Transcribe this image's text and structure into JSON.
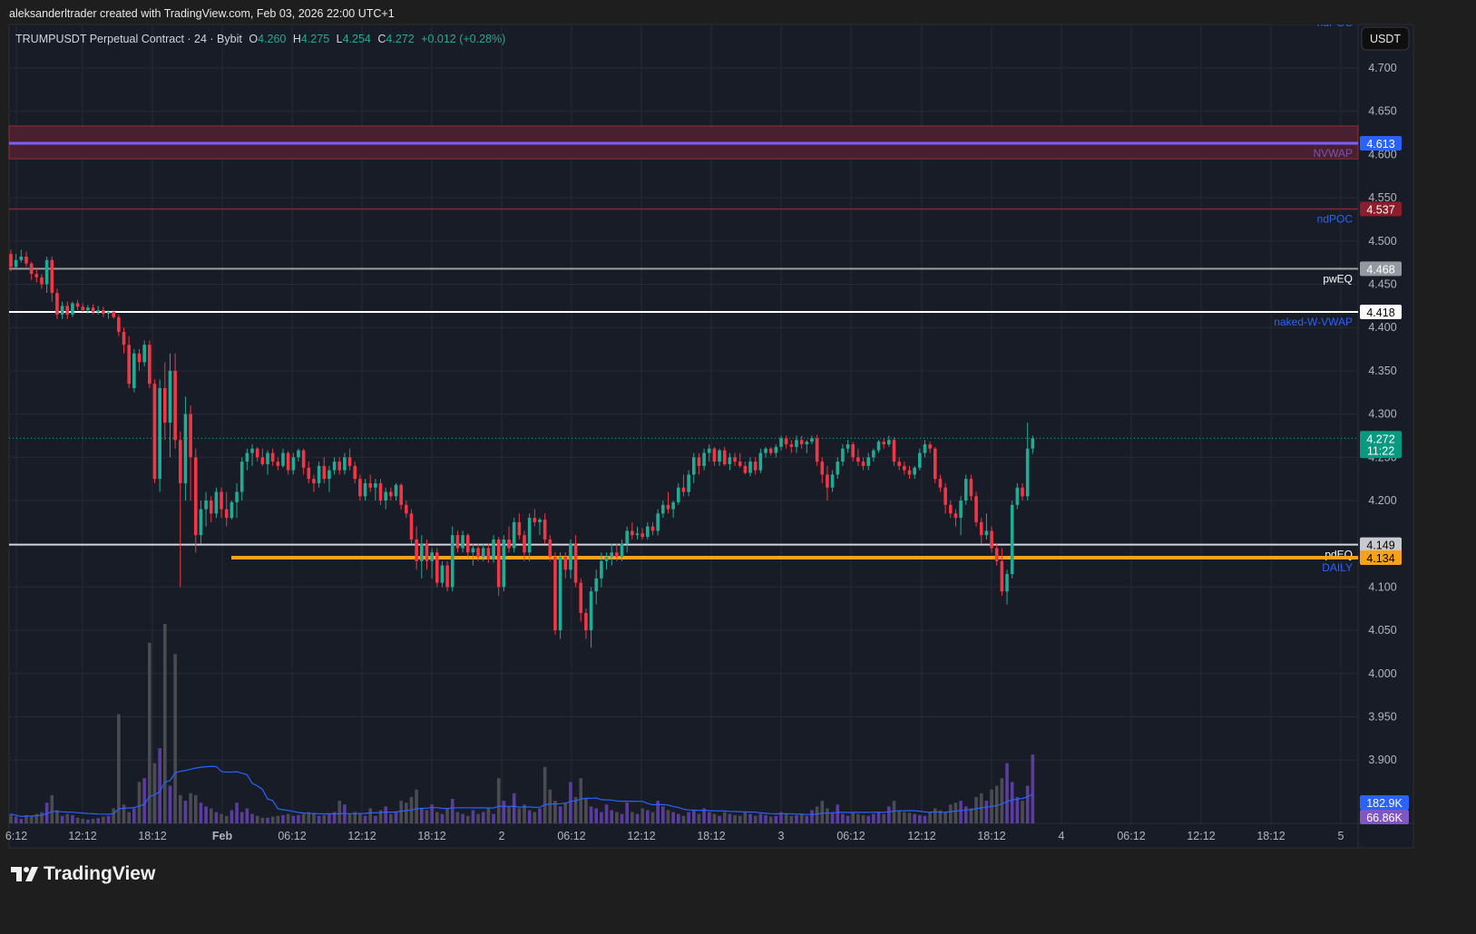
{
  "header": {
    "attribution": "aleksanderltrader created with TradingView.com, Feb 03, 2026 22:00 UTC+1"
  },
  "legend": {
    "symbol": "TRUMPUSDT Perpetual Contract · 24 · Bybit",
    "o_label": "O",
    "o": "4.260",
    "h_label": "H",
    "h": "4.275",
    "l_label": "L",
    "l": "4.254",
    "c_label": "C",
    "c": "4.272",
    "change": "+0.012 (+0.28%)"
  },
  "currency_button": "USDT",
  "brand": "TradingView",
  "colors": {
    "up": "#22ab94",
    "down": "#f23645",
    "vol_up": "#5b3c9f",
    "vol_down": "#4b4b52",
    "vol_ma": "#2962ff",
    "daily": "#f7a21b"
  },
  "chart_data": {
    "type": "candlestick",
    "title": "TRUMPUSDT Perpetual Contract · 24 · Bybit",
    "ylim": [
      3.88,
      4.73
    ],
    "y_ticks": [
      "4.700",
      "4.650",
      "4.600",
      "4.550",
      "4.500",
      "4.450",
      "4.400",
      "4.350",
      "4.300",
      "4.250",
      "4.200",
      "4.150",
      "4.100",
      "4.050",
      "4.000",
      "3.950",
      "3.900"
    ],
    "x_ticks": [
      "6:12",
      "12:12",
      "18:12",
      "Feb",
      "06:12",
      "12:12",
      "18:12",
      "2",
      "06:12",
      "12:12",
      "18:12",
      "3",
      "06:12",
      "12:12",
      "18:12",
      "4",
      "06:12",
      "12:12",
      "18:12",
      "5"
    ],
    "levels": [
      {
        "name": "NVWAP",
        "price": 4.613,
        "label": "4.613",
        "zone": [
          4.595,
          4.633
        ]
      },
      {
        "name": "ndPOC",
        "price": 4.537,
        "label": "4.537"
      },
      {
        "name": "pwEQ",
        "price": 4.468,
        "label": "4.468"
      },
      {
        "name": "naked-W-VWAP",
        "price": 4.418,
        "label": "4.418"
      },
      {
        "name": "pdEQ",
        "price": 4.149,
        "label": "4.149"
      },
      {
        "name": "DAILY",
        "price": 4.134,
        "label": "4.134"
      }
    ],
    "top_clipped_level": "ndPOC",
    "last_price": {
      "price": 4.272,
      "label": "4.272",
      "countdown": "11:22"
    },
    "volume_labels": {
      "last": "182.9K",
      "ma": "66.86K"
    },
    "candles": [
      [
        4.485,
        4.49,
        4.465,
        4.47
      ],
      [
        4.47,
        4.485,
        4.468,
        4.478
      ],
      [
        4.478,
        4.49,
        4.475,
        4.482
      ],
      [
        4.482,
        4.488,
        4.47,
        4.474
      ],
      [
        4.474,
        4.476,
        4.455,
        4.462
      ],
      [
        4.462,
        4.468,
        4.452,
        4.458
      ],
      [
        4.458,
        4.462,
        4.445,
        4.45
      ],
      [
        4.45,
        4.482,
        4.44,
        4.478
      ],
      [
        4.478,
        4.482,
        4.43,
        4.44
      ],
      [
        4.44,
        4.445,
        4.41,
        4.415
      ],
      [
        4.415,
        4.43,
        4.41,
        4.425
      ],
      [
        4.425,
        4.43,
        4.41,
        4.415
      ],
      [
        4.415,
        4.43,
        4.412,
        4.428
      ],
      [
        4.428,
        4.432,
        4.42,
        4.424
      ],
      [
        4.424,
        4.428,
        4.418,
        4.42
      ],
      [
        4.42,
        4.426,
        4.416,
        4.423
      ],
      [
        4.423,
        4.427,
        4.415,
        4.418
      ],
      [
        4.418,
        4.425,
        4.415,
        4.42
      ],
      [
        4.42,
        4.424,
        4.412,
        4.416
      ],
      [
        4.416,
        4.42,
        4.41,
        4.418
      ],
      [
        4.418,
        4.42,
        4.41,
        4.412
      ],
      [
        4.412,
        4.415,
        4.39,
        4.395
      ],
      [
        4.395,
        4.4,
        4.37,
        4.38
      ],
      [
        4.38,
        4.39,
        4.33,
        4.335
      ],
      [
        4.33,
        4.375,
        4.325,
        4.37
      ],
      [
        4.37,
        4.375,
        4.35,
        4.36
      ],
      [
        4.36,
        4.385,
        4.355,
        4.38
      ],
      [
        4.38,
        4.385,
        4.33,
        4.335
      ],
      [
        4.335,
        4.34,
        4.22,
        4.225
      ],
      [
        4.225,
        4.34,
        4.21,
        4.33
      ],
      [
        4.33,
        4.36,
        4.27,
        4.29
      ],
      [
        4.29,
        4.37,
        4.25,
        4.35
      ],
      [
        4.35,
        4.37,
        4.26,
        4.27
      ],
      [
        4.27,
        4.28,
        4.1,
        4.22
      ],
      [
        4.22,
        4.32,
        4.2,
        4.3
      ],
      [
        4.3,
        4.31,
        4.2,
        4.25
      ],
      [
        4.25,
        4.26,
        4.14,
        4.16
      ],
      [
        4.16,
        4.2,
        4.15,
        4.19
      ],
      [
        4.19,
        4.21,
        4.17,
        4.2
      ],
      [
        4.2,
        4.205,
        4.175,
        4.185
      ],
      [
        4.185,
        4.215,
        4.18,
        4.21
      ],
      [
        4.21,
        4.215,
        4.18,
        4.19
      ],
      [
        4.19,
        4.21,
        4.17,
        4.18
      ],
      [
        4.18,
        4.2,
        4.178,
        4.198
      ],
      [
        4.198,
        4.22,
        4.18,
        4.21
      ],
      [
        4.21,
        4.25,
        4.2,
        4.245
      ],
      [
        4.245,
        4.26,
        4.235,
        4.255
      ],
      [
        4.255,
        4.265,
        4.24,
        4.26
      ],
      [
        4.26,
        4.262,
        4.245,
        4.25
      ],
      [
        4.25,
        4.26,
        4.24,
        4.242
      ],
      [
        4.242,
        4.258,
        4.23,
        4.255
      ],
      [
        4.255,
        4.26,
        4.24,
        4.245
      ],
      [
        4.245,
        4.25,
        4.235,
        4.24
      ],
      [
        4.24,
        4.26,
        4.238,
        4.255
      ],
      [
        4.255,
        4.257,
        4.23,
        4.235
      ],
      [
        4.235,
        4.255,
        4.23,
        4.25
      ],
      [
        4.25,
        4.26,
        4.245,
        4.258
      ],
      [
        4.258,
        4.26,
        4.23,
        4.238
      ],
      [
        4.238,
        4.245,
        4.22,
        4.225
      ],
      [
        4.225,
        4.23,
        4.21,
        4.22
      ],
      [
        4.22,
        4.245,
        4.215,
        4.24
      ],
      [
        4.24,
        4.25,
        4.22,
        4.225
      ],
      [
        4.225,
        4.24,
        4.21,
        4.235
      ],
      [
        4.235,
        4.25,
        4.23,
        4.245
      ],
      [
        4.245,
        4.25,
        4.23,
        4.235
      ],
      [
        4.235,
        4.255,
        4.23,
        4.25
      ],
      [
        4.25,
        4.26,
        4.235,
        4.24
      ],
      [
        4.24,
        4.245,
        4.22,
        4.225
      ],
      [
        4.225,
        4.23,
        4.2,
        4.205
      ],
      [
        4.205,
        4.225,
        4.2,
        4.22
      ],
      [
        4.22,
        4.23,
        4.21,
        4.215
      ],
      [
        4.215,
        4.225,
        4.2,
        4.22
      ],
      [
        4.22,
        4.225,
        4.195,
        4.2
      ],
      [
        4.2,
        4.215,
        4.19,
        4.21
      ],
      [
        4.21,
        4.215,
        4.2,
        4.205
      ],
      [
        4.205,
        4.22,
        4.2,
        4.218
      ],
      [
        4.218,
        4.22,
        4.19,
        4.195
      ],
      [
        4.195,
        4.2,
        4.18,
        4.185
      ],
      [
        4.185,
        4.19,
        4.15,
        4.155
      ],
      [
        4.155,
        4.17,
        4.12,
        4.13
      ],
      [
        4.13,
        4.16,
        4.11,
        4.15
      ],
      [
        4.15,
        4.155,
        4.12,
        4.13
      ],
      [
        4.13,
        4.145,
        4.11,
        4.14
      ],
      [
        4.14,
        4.145,
        4.1,
        4.105
      ],
      [
        4.105,
        4.13,
        4.1,
        4.125
      ],
      [
        4.125,
        4.13,
        4.095,
        4.1
      ],
      [
        4.1,
        4.17,
        4.095,
        4.16
      ],
      [
        4.16,
        4.165,
        4.14,
        4.145
      ],
      [
        4.145,
        4.165,
        4.14,
        4.16
      ],
      [
        4.16,
        4.162,
        4.135,
        4.14
      ],
      [
        4.14,
        4.15,
        4.125,
        4.145
      ],
      [
        4.145,
        4.15,
        4.13,
        4.135
      ],
      [
        4.135,
        4.15,
        4.13,
        4.145
      ],
      [
        4.145,
        4.15,
        4.128,
        4.132
      ],
      [
        4.132,
        4.16,
        4.128,
        4.155
      ],
      [
        4.155,
        4.158,
        4.09,
        4.1
      ],
      [
        4.1,
        4.16,
        4.095,
        4.155
      ],
      [
        4.155,
        4.17,
        4.14,
        4.145
      ],
      [
        4.145,
        4.18,
        4.14,
        4.175
      ],
      [
        4.175,
        4.185,
        4.155,
        4.16
      ],
      [
        4.16,
        4.165,
        4.13,
        4.14
      ],
      [
        4.14,
        4.185,
        4.13,
        4.18
      ],
      [
        4.18,
        4.19,
        4.17,
        4.175
      ],
      [
        4.175,
        4.18,
        4.16,
        4.178
      ],
      [
        4.178,
        4.185,
        4.15,
        4.155
      ],
      [
        4.155,
        4.16,
        4.13,
        4.135
      ],
      [
        4.135,
        4.14,
        4.045,
        4.05
      ],
      [
        4.05,
        4.14,
        4.04,
        4.135
      ],
      [
        4.135,
        4.14,
        4.11,
        4.12
      ],
      [
        4.12,
        4.155,
        4.11,
        4.15
      ],
      [
        4.15,
        4.16,
        4.1,
        4.105
      ],
      [
        4.105,
        4.11,
        4.06,
        4.07
      ],
      [
        4.07,
        4.075,
        4.04,
        4.05
      ],
      [
        4.05,
        4.1,
        4.03,
        4.095
      ],
      [
        4.095,
        4.12,
        4.08,
        4.11
      ],
      [
        4.11,
        4.14,
        4.1,
        4.13
      ],
      [
        4.13,
        4.14,
        4.12,
        4.135
      ],
      [
        4.135,
        4.15,
        4.125,
        4.14
      ],
      [
        4.14,
        4.15,
        4.13,
        4.135
      ],
      [
        4.135,
        4.155,
        4.13,
        4.15
      ],
      [
        4.15,
        4.17,
        4.14,
        4.165
      ],
      [
        4.165,
        4.175,
        4.155,
        4.16
      ],
      [
        4.16,
        4.17,
        4.155,
        4.162
      ],
      [
        4.162,
        4.168,
        4.155,
        4.158
      ],
      [
        4.158,
        4.175,
        4.155,
        4.17
      ],
      [
        4.17,
        4.175,
        4.16,
        4.165
      ],
      [
        4.165,
        4.19,
        4.16,
        4.185
      ],
      [
        4.185,
        4.2,
        4.18,
        4.195
      ],
      [
        4.195,
        4.21,
        4.185,
        4.19
      ],
      [
        4.19,
        4.2,
        4.18,
        4.198
      ],
      [
        4.198,
        4.22,
        4.195,
        4.215
      ],
      [
        4.215,
        4.23,
        4.205,
        4.21
      ],
      [
        4.21,
        4.235,
        4.205,
        4.23
      ],
      [
        4.23,
        4.255,
        4.22,
        4.25
      ],
      [
        4.25,
        4.255,
        4.23,
        4.24
      ],
      [
        4.24,
        4.26,
        4.235,
        4.255
      ],
      [
        4.255,
        4.265,
        4.245,
        4.26
      ],
      [
        4.26,
        4.262,
        4.24,
        4.245
      ],
      [
        4.245,
        4.26,
        4.24,
        4.258
      ],
      [
        4.258,
        4.262,
        4.24,
        4.242
      ],
      [
        4.242,
        4.255,
        4.235,
        4.25
      ],
      [
        4.25,
        4.255,
        4.24,
        4.245
      ],
      [
        4.245,
        4.255,
        4.238,
        4.24
      ],
      [
        4.24,
        4.245,
        4.23,
        4.232
      ],
      [
        4.232,
        4.25,
        4.228,
        4.245
      ],
      [
        4.245,
        4.25,
        4.23,
        4.235
      ],
      [
        4.235,
        4.26,
        4.232,
        4.255
      ],
      [
        4.255,
        4.262,
        4.25,
        4.26
      ],
      [
        4.26,
        4.262,
        4.252,
        4.255
      ],
      [
        4.255,
        4.265,
        4.25,
        4.262
      ],
      [
        4.262,
        4.275,
        4.258,
        4.272
      ],
      [
        4.272,
        4.275,
        4.26,
        4.265
      ],
      [
        4.265,
        4.27,
        4.255,
        4.262
      ],
      [
        4.262,
        4.275,
        4.255,
        4.27
      ],
      [
        4.27,
        4.275,
        4.26,
        4.265
      ],
      [
        4.265,
        4.27,
        4.255,
        4.268
      ],
      [
        4.268,
        4.275,
        4.265,
        4.272
      ],
      [
        4.272,
        4.276,
        4.24,
        4.245
      ],
      [
        4.245,
        4.25,
        4.22,
        4.23
      ],
      [
        4.23,
        4.24,
        4.2,
        4.215
      ],
      [
        4.215,
        4.235,
        4.21,
        4.23
      ],
      [
        4.23,
        4.25,
        4.225,
        4.245
      ],
      [
        4.245,
        4.265,
        4.24,
        4.26
      ],
      [
        4.26,
        4.27,
        4.255,
        4.265
      ],
      [
        4.265,
        4.268,
        4.245,
        4.25
      ],
      [
        4.25,
        4.26,
        4.24,
        4.245
      ],
      [
        4.245,
        4.25,
        4.235,
        4.24
      ],
      [
        4.24,
        4.255,
        4.235,
        4.25
      ],
      [
        4.25,
        4.26,
        4.245,
        4.258
      ],
      [
        4.258,
        4.27,
        4.255,
        4.268
      ],
      [
        4.268,
        4.272,
        4.26,
        4.265
      ],
      [
        4.265,
        4.275,
        4.262,
        4.27
      ],
      [
        4.27,
        4.273,
        4.24,
        4.245
      ],
      [
        4.245,
        4.25,
        4.235,
        4.24
      ],
      [
        4.24,
        4.245,
        4.23,
        4.235
      ],
      [
        4.235,
        4.24,
        4.225,
        4.23
      ],
      [
        4.23,
        4.24,
        4.225,
        4.238
      ],
      [
        4.238,
        4.26,
        4.235,
        4.255
      ],
      [
        4.255,
        4.27,
        4.25,
        4.265
      ],
      [
        4.265,
        4.268,
        4.255,
        4.26
      ],
      [
        4.26,
        4.262,
        4.22,
        4.225
      ],
      [
        4.225,
        4.23,
        4.21,
        4.215
      ],
      [
        4.215,
        4.22,
        4.185,
        4.195
      ],
      [
        4.195,
        4.2,
        4.18,
        4.185
      ],
      [
        4.185,
        4.19,
        4.17,
        4.18
      ],
      [
        4.18,
        4.205,
        4.16,
        4.2
      ],
      [
        4.2,
        4.23,
        4.195,
        4.225
      ],
      [
        4.225,
        4.23,
        4.2,
        4.205
      ],
      [
        4.205,
        4.21,
        4.17,
        4.175
      ],
      [
        4.175,
        4.18,
        4.15,
        4.16
      ],
      [
        4.16,
        4.185,
        4.155,
        4.165
      ],
      [
        4.165,
        4.17,
        4.14,
        4.145
      ],
      [
        4.145,
        4.15,
        4.125,
        4.13
      ],
      [
        4.13,
        4.145,
        4.09,
        4.095
      ],
      [
        4.095,
        4.12,
        4.08,
        4.115
      ],
      [
        4.115,
        4.2,
        4.11,
        4.195
      ],
      [
        4.195,
        4.22,
        4.19,
        4.215
      ],
      [
        4.215,
        4.22,
        4.2,
        4.205
      ],
      [
        4.205,
        4.29,
        4.2,
        4.26
      ],
      [
        4.26,
        4.275,
        4.254,
        4.272
      ]
    ],
    "volume_k": [
      25,
      18,
      12,
      22,
      20,
      25,
      30,
      55,
      75,
      35,
      20,
      25,
      22,
      15,
      12,
      10,
      12,
      14,
      18,
      20,
      40,
      290,
      50,
      30,
      40,
      110,
      120,
      480,
      160,
      200,
      530,
      100,
      450,
      75,
      60,
      80,
      75,
      55,
      45,
      40,
      30,
      25,
      20,
      35,
      55,
      30,
      40,
      25,
      20,
      15,
      15,
      18,
      20,
      22,
      25,
      20,
      22,
      25,
      30,
      28,
      20,
      22,
      25,
      30,
      60,
      50,
      25,
      30,
      25,
      20,
      40,
      20,
      35,
      45,
      25,
      30,
      60,
      55,
      70,
      90,
      40,
      35,
      50,
      30,
      25,
      40,
      65,
      30,
      25,
      20,
      35,
      25,
      30,
      40,
      25,
      120,
      60,
      45,
      80,
      40,
      50,
      35,
      30,
      40,
      150,
      90,
      60,
      45,
      55,
      110,
      70,
      120,
      65,
      45,
      40,
      30,
      50,
      35,
      30,
      25,
      55,
      30,
      25,
      40,
      35,
      30,
      60,
      45,
      35,
      30,
      25,
      20,
      30,
      35,
      25,
      40,
      30,
      25,
      20,
      30,
      25,
      22,
      20,
      30,
      25,
      20,
      25,
      22,
      18,
      20,
      30,
      25,
      20,
      22,
      25,
      20,
      35,
      45,
      60,
      40,
      30,
      50,
      25,
      20,
      30,
      25,
      22,
      20,
      25,
      30,
      25,
      45,
      60,
      35,
      30,
      28,
      25,
      22,
      20,
      30,
      40,
      35,
      30,
      50,
      55,
      60,
      45,
      40,
      70,
      80,
      60,
      90,
      100,
      120,
      160,
      110,
      70,
      60,
      100,
      182.9
    ]
  }
}
